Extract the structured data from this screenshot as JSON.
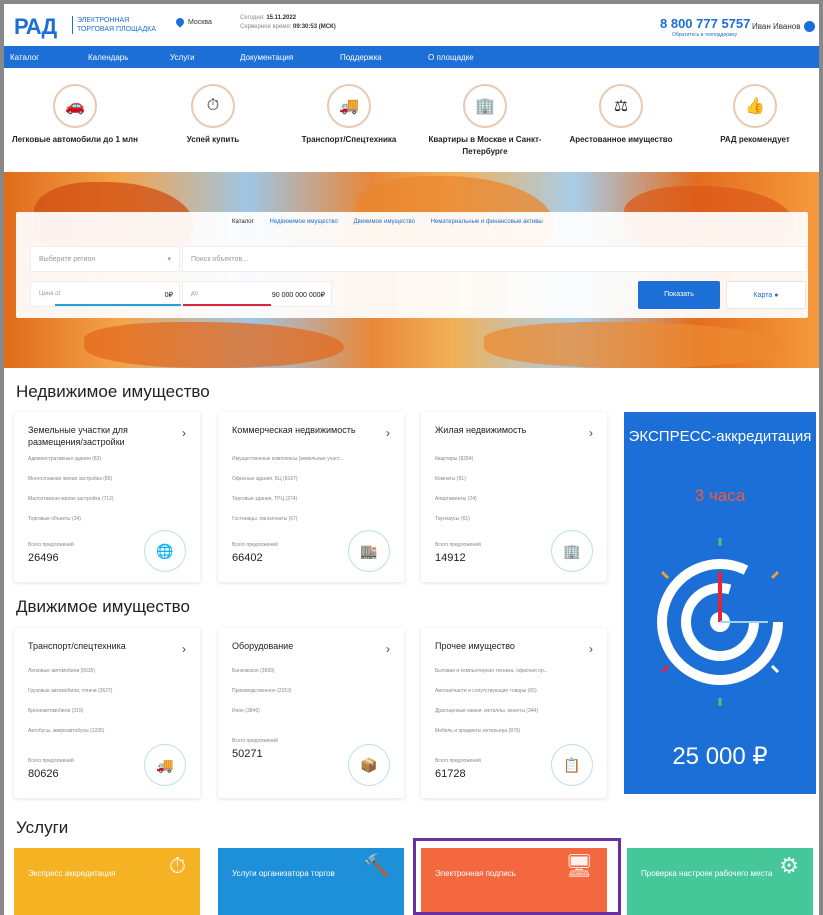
{
  "header": {
    "logo": "РАД",
    "logo_sub": "ЭЛЕКТРОННАЯ ТОРГОВАЯ ПЛОЩАДКА",
    "city": "Москва",
    "date_label": "Сегодня:",
    "date": "15.11.2022",
    "time_label": "Серверное время:",
    "time": "09:30:53 (МСК)",
    "phone": "8 800 777 5757",
    "phone_sub": "Обратитесь в техподдержку",
    "user": "Иван Иванов"
  },
  "nav": [
    "Каталог",
    "Календарь",
    "Услуги",
    "Документация",
    "Поддержка",
    "О площадке"
  ],
  "categories": [
    {
      "label": "Легковые автомобили до 1 млн",
      "icon": "car-icon"
    },
    {
      "label": "Успей купить",
      "icon": "stopwatch-icon"
    },
    {
      "label": "Транспорт/Спецтехника",
      "icon": "truck-icon"
    },
    {
      "label": "Квартиры в Москве и Санкт-Петербурге",
      "icon": "buildings-icon"
    },
    {
      "label": "Арестованное имущество",
      "icon": "gavel-icon"
    },
    {
      "label": "РАД рекомендует",
      "icon": "thumbs-up-icon"
    }
  ],
  "search": {
    "tabs": [
      "Каталог",
      "Недвижимое имущество",
      "Движимое имущество",
      "Нематериальные и финансовые активы"
    ],
    "region_placeholder": "Выберите регион",
    "objects_placeholder": "Поиск объектов...",
    "price_from_label": "Цена от",
    "price_from": "0₽",
    "price_to_label": "до",
    "price_to": "90 000 000 000₽",
    "show": "Показать",
    "map": "Карта"
  },
  "realty": {
    "title": "Недвижимое имущество",
    "cards": [
      {
        "title": "Земельные участки для размещения/застройки",
        "items": [
          "Административные здания (83)",
          "Многоэтажная жилая застройка (86)",
          "Малоэтажная жилая застройка (712)",
          "Торговые объекты (34)"
        ],
        "total_label": "Всего предложений",
        "total": "26496",
        "icon": "globe-icon"
      },
      {
        "title": "Коммерческая недвижимость",
        "items": [
          "Имущественные комплексы (земельные участ...",
          "Офисные здания, БЦ (8167)",
          "Торговые здания, ТРЦ (274)",
          "Гостиницы, пансионаты (67)"
        ],
        "total_label": "Всего предложений",
        "total": "66402",
        "icon": "office-icon"
      },
      {
        "title": "Жилая недвижимость",
        "items": [
          "Квартиры (8284)",
          "Комнаты (91)",
          "Апартаменты (24)",
          "Таунхаусы (61)"
        ],
        "total_label": "Всего предложений",
        "total": "14912",
        "icon": "buildings-icon"
      }
    ]
  },
  "movables": {
    "title": "Движимое имущество",
    "cards": [
      {
        "title": "Транспорт/спецтехника",
        "items": [
          "Легковые автомобили (5635)",
          "Грузовые автомобили, тягачи (3627)",
          "Бронеавтомобили (319)",
          "Автобусы, микроавтобусы (1335)"
        ],
        "total_label": "Всего предложений",
        "total": "80626",
        "icon": "truck-icon"
      },
      {
        "title": "Оборудование",
        "items": [
          "Банковское (3699)",
          "Производственное (2153)",
          "Иное (3846)"
        ],
        "total_label": "Всего предложений",
        "total": "50271",
        "icon": "box-icon"
      },
      {
        "title": "Прочее имущество",
        "items": [
          "Бытовая и компьютерная техника, офисная ор...",
          "Автозапчасти и сопутствующие товары (65)",
          "Драгоценные камни, металлы, монеты (344)",
          "Мебель и предметы интерьера (879)"
        ],
        "total_label": "Всего предложений",
        "total": "61728",
        "icon": "clipboard-icon"
      }
    ]
  },
  "express": {
    "title": "ЭКСПРЕСС-аккредитация",
    "time": "3 часа",
    "price": "25 000 ₽"
  },
  "services": {
    "title": "Услуги",
    "items": [
      {
        "label": "Экспресс аккредитация",
        "color": "#f5b324"
      },
      {
        "label": "Услуги организатора торгов",
        "color": "#1e8fd9"
      },
      {
        "label": "Электронная подпись",
        "color": "#f4683f"
      },
      {
        "label": "Проверка настроек рабочего места",
        "color": "#46c79a"
      }
    ]
  }
}
